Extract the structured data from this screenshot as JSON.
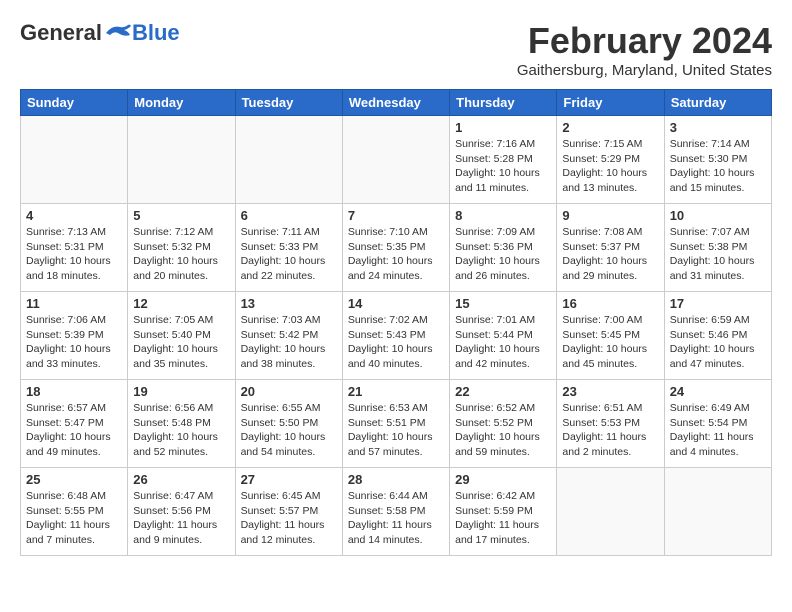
{
  "header": {
    "logo": {
      "general": "General",
      "blue": "Blue"
    },
    "title": "February 2024",
    "location": "Gaithersburg, Maryland, United States"
  },
  "weekdays": [
    "Sunday",
    "Monday",
    "Tuesday",
    "Wednesday",
    "Thursday",
    "Friday",
    "Saturday"
  ],
  "weeks": [
    [
      {
        "day": "",
        "info": ""
      },
      {
        "day": "",
        "info": ""
      },
      {
        "day": "",
        "info": ""
      },
      {
        "day": "",
        "info": ""
      },
      {
        "day": "1",
        "info": "Sunrise: 7:16 AM\nSunset: 5:28 PM\nDaylight: 10 hours\nand 11 minutes."
      },
      {
        "day": "2",
        "info": "Sunrise: 7:15 AM\nSunset: 5:29 PM\nDaylight: 10 hours\nand 13 minutes."
      },
      {
        "day": "3",
        "info": "Sunrise: 7:14 AM\nSunset: 5:30 PM\nDaylight: 10 hours\nand 15 minutes."
      }
    ],
    [
      {
        "day": "4",
        "info": "Sunrise: 7:13 AM\nSunset: 5:31 PM\nDaylight: 10 hours\nand 18 minutes."
      },
      {
        "day": "5",
        "info": "Sunrise: 7:12 AM\nSunset: 5:32 PM\nDaylight: 10 hours\nand 20 minutes."
      },
      {
        "day": "6",
        "info": "Sunrise: 7:11 AM\nSunset: 5:33 PM\nDaylight: 10 hours\nand 22 minutes."
      },
      {
        "day": "7",
        "info": "Sunrise: 7:10 AM\nSunset: 5:35 PM\nDaylight: 10 hours\nand 24 minutes."
      },
      {
        "day": "8",
        "info": "Sunrise: 7:09 AM\nSunset: 5:36 PM\nDaylight: 10 hours\nand 26 minutes."
      },
      {
        "day": "9",
        "info": "Sunrise: 7:08 AM\nSunset: 5:37 PM\nDaylight: 10 hours\nand 29 minutes."
      },
      {
        "day": "10",
        "info": "Sunrise: 7:07 AM\nSunset: 5:38 PM\nDaylight: 10 hours\nand 31 minutes."
      }
    ],
    [
      {
        "day": "11",
        "info": "Sunrise: 7:06 AM\nSunset: 5:39 PM\nDaylight: 10 hours\nand 33 minutes."
      },
      {
        "day": "12",
        "info": "Sunrise: 7:05 AM\nSunset: 5:40 PM\nDaylight: 10 hours\nand 35 minutes."
      },
      {
        "day": "13",
        "info": "Sunrise: 7:03 AM\nSunset: 5:42 PM\nDaylight: 10 hours\nand 38 minutes."
      },
      {
        "day": "14",
        "info": "Sunrise: 7:02 AM\nSunset: 5:43 PM\nDaylight: 10 hours\nand 40 minutes."
      },
      {
        "day": "15",
        "info": "Sunrise: 7:01 AM\nSunset: 5:44 PM\nDaylight: 10 hours\nand 42 minutes."
      },
      {
        "day": "16",
        "info": "Sunrise: 7:00 AM\nSunset: 5:45 PM\nDaylight: 10 hours\nand 45 minutes."
      },
      {
        "day": "17",
        "info": "Sunrise: 6:59 AM\nSunset: 5:46 PM\nDaylight: 10 hours\nand 47 minutes."
      }
    ],
    [
      {
        "day": "18",
        "info": "Sunrise: 6:57 AM\nSunset: 5:47 PM\nDaylight: 10 hours\nand 49 minutes."
      },
      {
        "day": "19",
        "info": "Sunrise: 6:56 AM\nSunset: 5:48 PM\nDaylight: 10 hours\nand 52 minutes."
      },
      {
        "day": "20",
        "info": "Sunrise: 6:55 AM\nSunset: 5:50 PM\nDaylight: 10 hours\nand 54 minutes."
      },
      {
        "day": "21",
        "info": "Sunrise: 6:53 AM\nSunset: 5:51 PM\nDaylight: 10 hours\nand 57 minutes."
      },
      {
        "day": "22",
        "info": "Sunrise: 6:52 AM\nSunset: 5:52 PM\nDaylight: 10 hours\nand 59 minutes."
      },
      {
        "day": "23",
        "info": "Sunrise: 6:51 AM\nSunset: 5:53 PM\nDaylight: 11 hours\nand 2 minutes."
      },
      {
        "day": "24",
        "info": "Sunrise: 6:49 AM\nSunset: 5:54 PM\nDaylight: 11 hours\nand 4 minutes."
      }
    ],
    [
      {
        "day": "25",
        "info": "Sunrise: 6:48 AM\nSunset: 5:55 PM\nDaylight: 11 hours\nand 7 minutes."
      },
      {
        "day": "26",
        "info": "Sunrise: 6:47 AM\nSunset: 5:56 PM\nDaylight: 11 hours\nand 9 minutes."
      },
      {
        "day": "27",
        "info": "Sunrise: 6:45 AM\nSunset: 5:57 PM\nDaylight: 11 hours\nand 12 minutes."
      },
      {
        "day": "28",
        "info": "Sunrise: 6:44 AM\nSunset: 5:58 PM\nDaylight: 11 hours\nand 14 minutes."
      },
      {
        "day": "29",
        "info": "Sunrise: 6:42 AM\nSunset: 5:59 PM\nDaylight: 11 hours\nand 17 minutes."
      },
      {
        "day": "",
        "info": ""
      },
      {
        "day": "",
        "info": ""
      }
    ]
  ]
}
